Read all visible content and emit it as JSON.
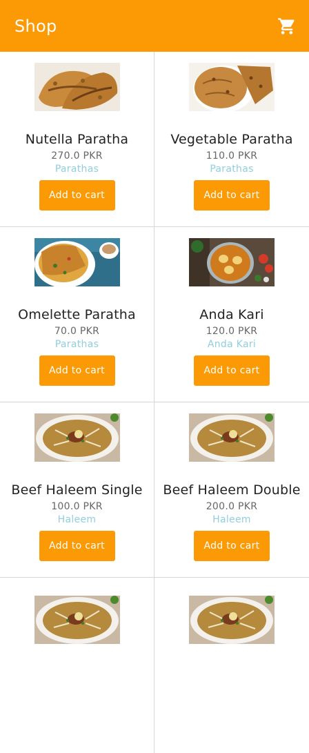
{
  "app_bar": {
    "title": "Shop",
    "cart_icon": "shopping-cart-icon",
    "color": "#fb9a05"
  },
  "products": [
    {
      "name": "Nutella Paratha",
      "price": "270.0 PKR",
      "category": "Parathas",
      "button": "Add to cart",
      "image": "paratha-image"
    },
    {
      "name": "Vegetable Paratha",
      "price": "110.0 PKR",
      "category": "Parathas",
      "button": "Add to cart",
      "image": "paratha-image"
    },
    {
      "name": "Omelette Paratha",
      "price": "70.0 PKR",
      "category": "Parathas",
      "button": "Add to cart",
      "image": "omelette-paratha-image"
    },
    {
      "name": "Anda Kari",
      "price": "120.0 PKR",
      "category": "Anda Kari",
      "button": "Add to cart",
      "image": "egg-curry-image"
    },
    {
      "name": "Beef Haleem Single",
      "price": "100.0 PKR",
      "category": "Haleem",
      "button": "Add to cart",
      "image": "haleem-image"
    },
    {
      "name": "Beef Haleem Double",
      "price": "200.0 PKR",
      "category": "Haleem",
      "button": "Add to cart",
      "image": "haleem-image"
    }
  ],
  "colors": {
    "accent": "#fb9a05",
    "category_text": "#8fcfdf",
    "divider": "#d6d6d6"
  }
}
